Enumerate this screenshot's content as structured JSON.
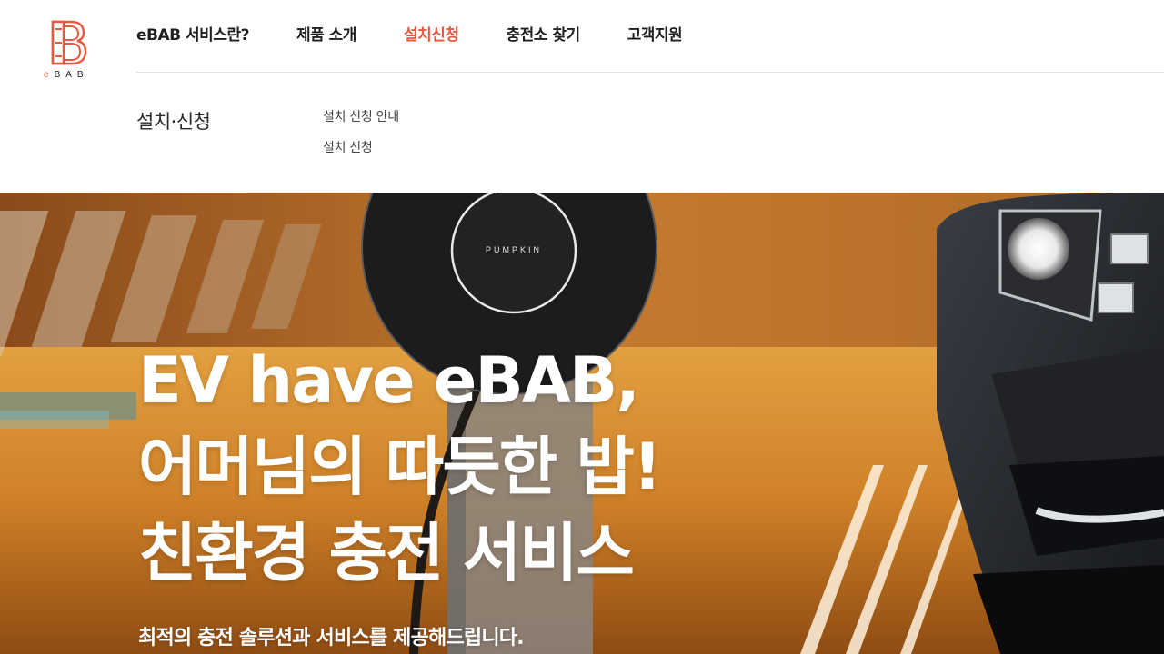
{
  "logo": {
    "text_e": "e",
    "text_rest": "BAB",
    "icon": "ebab-logo-icon"
  },
  "nav": {
    "items": [
      {
        "label": "eBAB 서비스란?"
      },
      {
        "label": "제품 소개"
      },
      {
        "label": "설치신청"
      },
      {
        "label": "충전소 찾기"
      },
      {
        "label": "고객지원"
      }
    ],
    "active_index": 2
  },
  "submenu": {
    "title": "설치·신청",
    "links": [
      {
        "label": "설치 신청 안내"
      },
      {
        "label": "설치 신청"
      }
    ]
  },
  "hero": {
    "charger_brand": "PUMPKIN",
    "headline": [
      "EV have eBAB,",
      "어머님의 따듯한 밥!",
      "친환경 충전 서비스"
    ],
    "subline": "최적의 충전 솔루션과 서비스를 제공해드립니다."
  },
  "colors": {
    "accent": "#e8583f",
    "nav_text": "#1f1f1f",
    "hero_text": "#ffffff"
  }
}
